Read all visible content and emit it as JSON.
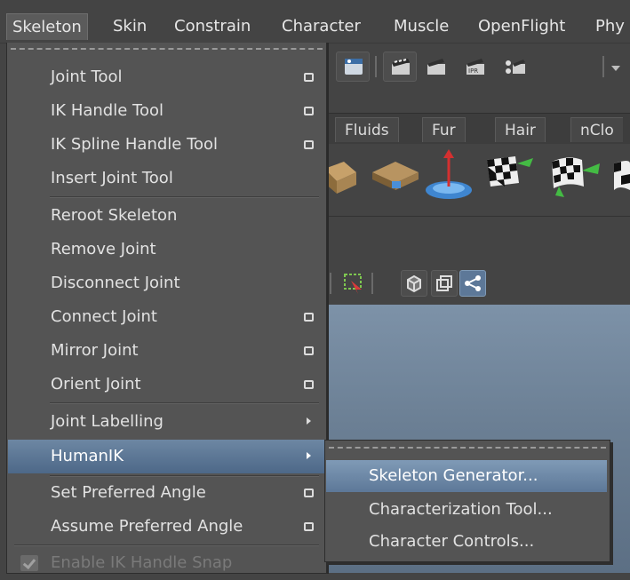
{
  "menubar": {
    "items": [
      "Skeleton",
      "Skin",
      "Constrain",
      "Character",
      "Muscle",
      "OpenFlight",
      "Phy"
    ],
    "active": "Skeleton"
  },
  "tabs": [
    "Fluids",
    "Fur",
    "Hair",
    "nClo"
  ],
  "skeleton_menu": {
    "items": [
      {
        "label": "Joint Tool",
        "option_box": true
      },
      {
        "label": "IK Handle Tool",
        "option_box": true
      },
      {
        "label": "IK Spline Handle Tool",
        "option_box": true
      },
      {
        "label": "Insert Joint Tool",
        "option_box": false
      },
      {
        "label": "Reroot Skeleton",
        "option_box": false
      },
      {
        "label": "Remove Joint",
        "option_box": false
      },
      {
        "label": "Disconnect Joint",
        "option_box": false
      },
      {
        "label": "Connect Joint",
        "option_box": true
      },
      {
        "label": "Mirror Joint",
        "option_box": true
      },
      {
        "label": "Orient Joint",
        "option_box": true
      },
      {
        "label": "Joint Labelling",
        "submenu": true
      },
      {
        "label": "HumanIK",
        "submenu": true,
        "highlighted": true
      },
      {
        "label": "Set Preferred Angle",
        "option_box": true
      },
      {
        "label": "Assume Preferred Angle",
        "option_box": true
      },
      {
        "label": "Enable IK Handle Snap",
        "checked": true,
        "disabled": true
      }
    ]
  },
  "humanik_submenu": {
    "items": [
      {
        "label": "Skeleton Generator...",
        "highlighted": true
      },
      {
        "label": "Characterization Tool..."
      },
      {
        "label": "Character Controls..."
      }
    ]
  },
  "colors": {
    "menu_bg": "#545454",
    "highlight": "#5d7898",
    "viewport": "#6b7f94"
  }
}
